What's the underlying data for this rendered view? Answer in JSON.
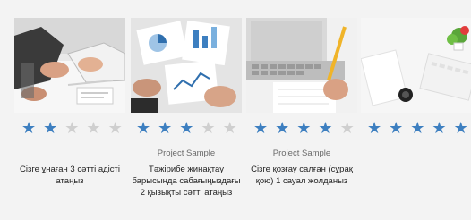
{
  "rating_color_on": "#3d7fc0",
  "rating_color_off": "#cfcfcf",
  "cards": [
    {
      "image": "business-meeting-hands-photo",
      "rating": 2,
      "max_rating": 5,
      "label": "",
      "description": "Сізге ұнаған 3 сәтті адісті атаңыз"
    },
    {
      "image": "documents-charts-desk-photo",
      "rating": 3,
      "max_rating": 5,
      "label": "Project Sample",
      "description": "Тәжірибе жинақтау барысында сабағыңыздағы 2 қызықты сәтті атаңыз"
    },
    {
      "image": "laptop-pencil-writing-photo",
      "rating": 4,
      "max_rating": 5,
      "label": "Project Sample",
      "description": "Сізге қозғау салған (сұрақ қою) 1 сауал жолданыз"
    },
    {
      "image": "white-desk-keyboard-plant-photo",
      "rating": 5,
      "max_rating": 5,
      "label": "",
      "description": ""
    }
  ]
}
